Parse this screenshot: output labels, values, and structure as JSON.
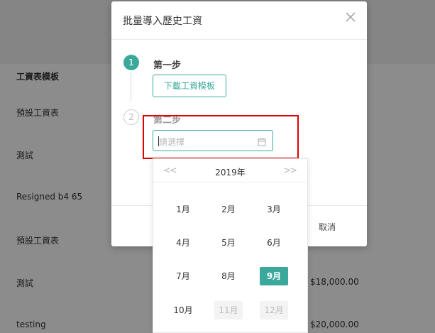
{
  "background": {
    "header": "工資表模板",
    "rows": [
      "預設工資表",
      "測試",
      "Resigned b4 65",
      "預設工資表",
      "測試",
      "testing"
    ],
    "amounts": [
      "$18,000.00",
      "$20,000.00"
    ]
  },
  "modal": {
    "title": "批量導入歷史工資",
    "steps": [
      {
        "number": "1",
        "title": "第一步",
        "button": "下載工資模板"
      },
      {
        "number": "2",
        "title": "第二步"
      }
    ],
    "date_placeholder": "請選擇",
    "cancel_label": "取消"
  },
  "year_picker": {
    "year": "2019年",
    "prev": "<<",
    "next": ">>",
    "months": [
      {
        "label": "1月",
        "state": "normal"
      },
      {
        "label": "2月",
        "state": "normal"
      },
      {
        "label": "3月",
        "state": "normal"
      },
      {
        "label": "4月",
        "state": "normal"
      },
      {
        "label": "5月",
        "state": "normal"
      },
      {
        "label": "6月",
        "state": "normal"
      },
      {
        "label": "7月",
        "state": "normal"
      },
      {
        "label": "8月",
        "state": "normal"
      },
      {
        "label": "9月",
        "state": "selected"
      },
      {
        "label": "10月",
        "state": "normal"
      },
      {
        "label": "11月",
        "state": "disabled"
      },
      {
        "label": "12月",
        "state": "disabled"
      }
    ]
  },
  "colors": {
    "accent": "#3aa99c",
    "highlight": "#e00000"
  }
}
